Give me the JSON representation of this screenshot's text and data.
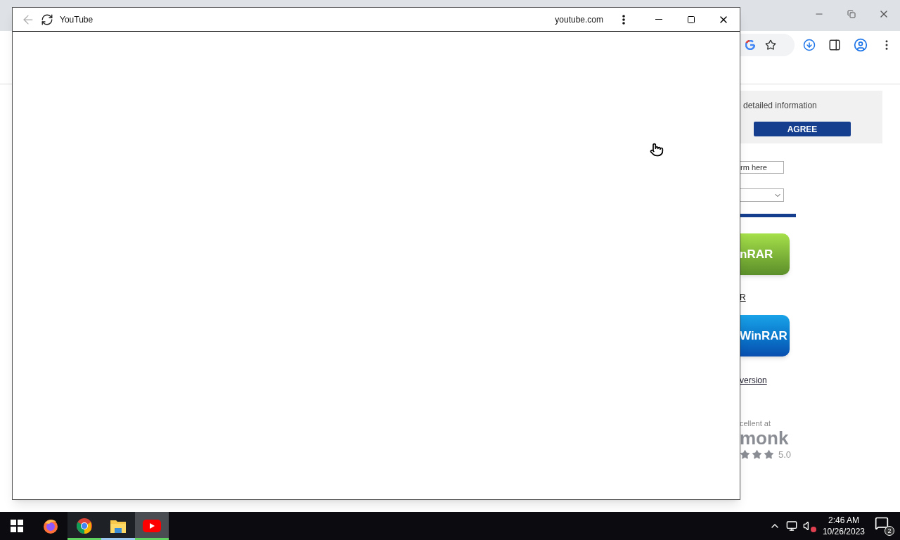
{
  "popup": {
    "title": "YouTube",
    "back_disabled": true,
    "domain": "youtube.com"
  },
  "background_page": {
    "cookie_text": "detailed information",
    "agree_button": "AGREE",
    "search_placeholder": "rm here",
    "download_button": "nRAR",
    "link_1": "R",
    "download_button_2": "WinRAR",
    "link_2": "version",
    "review_text": "cellent at",
    "review_brand": "monk",
    "rating": {
      "stars": 3,
      "reading": "5.0"
    }
  },
  "taskbar": {
    "apps": [
      {
        "kind": "start",
        "open": false,
        "selected": false
      },
      {
        "kind": "firefox",
        "open": false,
        "selected": false
      },
      {
        "kind": "chrome",
        "open": true,
        "selected": false,
        "color": "#5fd25f"
      },
      {
        "kind": "files",
        "open": true,
        "selected": false,
        "color": "#9cc8f0"
      },
      {
        "kind": "youtube",
        "open": true,
        "selected": true,
        "color": "#5fd25f"
      }
    ],
    "time": "2:46 AM",
    "date": "10/26/2023",
    "notifications": "2",
    "volume_muted": true
  }
}
